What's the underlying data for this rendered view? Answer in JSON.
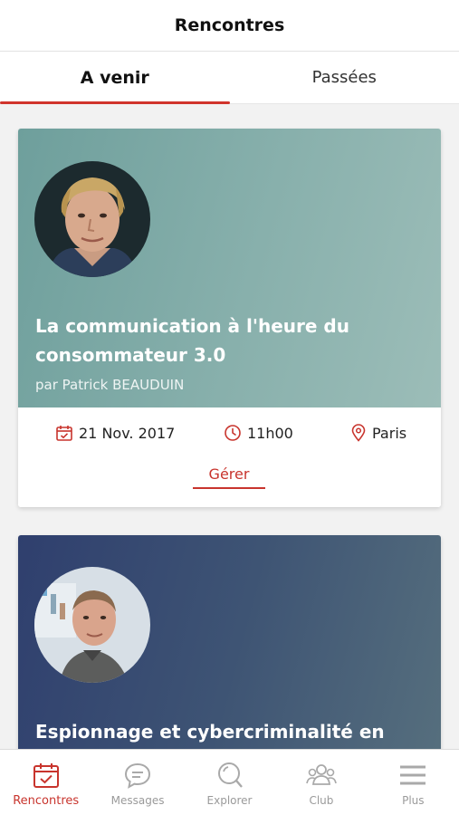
{
  "header": {
    "title": "Rencontres"
  },
  "tabs": [
    {
      "label": "A venir",
      "active": true
    },
    {
      "label": "Passées",
      "active": false
    }
  ],
  "events": [
    {
      "title_line1": "La communication à l'heure du",
      "title_line2": "consommateur 3.0",
      "author": "par Patrick BEAUDUIN",
      "date": "21 Nov. 2017",
      "time": "11h00",
      "place": "Paris",
      "action_label": "Gérer"
    },
    {
      "title_line1": "Espionnage et cybercriminalité en",
      "title_line2": ""
    }
  ],
  "bottom_nav": [
    {
      "label": "Rencontres",
      "icon": "calendar-check-icon",
      "active": true
    },
    {
      "label": "Messages",
      "icon": "chat-bubble-icon",
      "active": false
    },
    {
      "label": "Explorer",
      "icon": "search-icon",
      "active": false
    },
    {
      "label": "Club",
      "icon": "group-icon",
      "active": false
    },
    {
      "label": "Plus",
      "icon": "menu-icon",
      "active": false
    }
  ],
  "colors": {
    "accent": "#c8342d",
    "card1_hero": "#88b0ac",
    "card2_hero": "#3e5474"
  }
}
